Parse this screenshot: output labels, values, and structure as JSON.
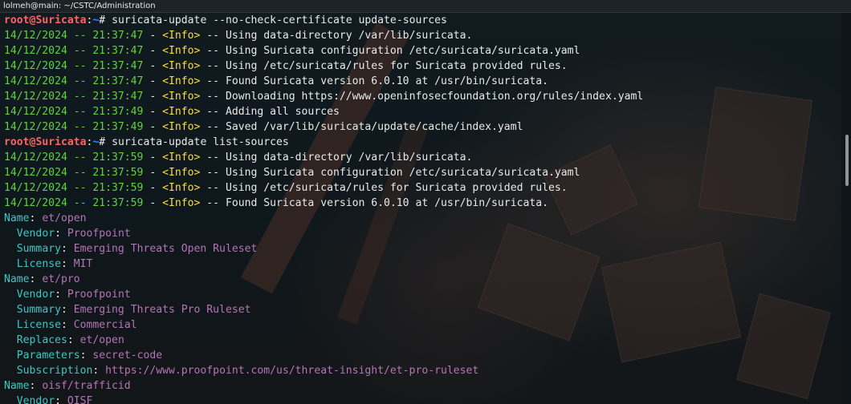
{
  "window": {
    "title": "lolmeh@main: ~/CSTC/Administration"
  },
  "prompt": {
    "user": "root",
    "at": "@",
    "host": "Suricata",
    "colon": ":",
    "path": "~",
    "symbol": "# "
  },
  "commands": [
    "suricata-update --no-check-certificate update-sources",
    "suricata-update list-sources"
  ],
  "log_block_1": [
    {
      "time": "14/12/2024 -- 21:37:47",
      "level": "<Info>",
      "message": "Using data-directory /var/lib/suricata."
    },
    {
      "time": "14/12/2024 -- 21:37:47",
      "level": "<Info>",
      "message": "Using Suricata configuration /etc/suricata/suricata.yaml"
    },
    {
      "time": "14/12/2024 -- 21:37:47",
      "level": "<Info>",
      "message": "Using /etc/suricata/rules for Suricata provided rules."
    },
    {
      "time": "14/12/2024 -- 21:37:47",
      "level": "<Info>",
      "message": "Found Suricata version 6.0.10 at /usr/bin/suricata."
    },
    {
      "time": "14/12/2024 -- 21:37:47",
      "level": "<Info>",
      "message": "Downloading https://www.openinfosecfoundation.org/rules/index.yaml"
    },
    {
      "time": "14/12/2024 -- 21:37:49",
      "level": "<Info>",
      "message": "Adding all sources"
    },
    {
      "time": "14/12/2024 -- 21:37:49",
      "level": "<Info>",
      "message": "Saved /var/lib/suricata/update/cache/index.yaml"
    }
  ],
  "log_block_2": [
    {
      "time": "14/12/2024 -- 21:37:59",
      "level": "<Info>",
      "message": "Using data-directory /var/lib/suricata."
    },
    {
      "time": "14/12/2024 -- 21:37:59",
      "level": "<Info>",
      "message": "Using Suricata configuration /etc/suricata/suricata.yaml"
    },
    {
      "time": "14/12/2024 -- 21:37:59",
      "level": "<Info>",
      "message": "Using /etc/suricata/rules for Suricata provided rules."
    },
    {
      "time": "14/12/2024 -- 21:37:59",
      "level": "<Info>",
      "message": "Found Suricata version 6.0.10 at /usr/bin/suricata."
    }
  ],
  "sources": [
    {
      "indent": "",
      "key": "Name",
      "value": "et/open"
    },
    {
      "indent": "  ",
      "key": "Vendor",
      "value": "Proofpoint"
    },
    {
      "indent": "  ",
      "key": "Summary",
      "value": "Emerging Threats Open Ruleset"
    },
    {
      "indent": "  ",
      "key": "License",
      "value": "MIT"
    },
    {
      "indent": "",
      "key": "Name",
      "value": "et/pro"
    },
    {
      "indent": "  ",
      "key": "Vendor",
      "value": "Proofpoint"
    },
    {
      "indent": "  ",
      "key": "Summary",
      "value": "Emerging Threats Pro Ruleset"
    },
    {
      "indent": "  ",
      "key": "License",
      "value": "Commercial"
    },
    {
      "indent": "  ",
      "key": "Replaces",
      "value": "et/open"
    },
    {
      "indent": "  ",
      "key": "Parameters",
      "value": "secret-code"
    },
    {
      "indent": "  ",
      "key": "Subscription",
      "value": "https://www.proofpoint.com/us/threat-insight/et-pro-ruleset"
    },
    {
      "indent": "",
      "key": "Name",
      "value": "oisf/trafficid"
    },
    {
      "indent": "  ",
      "key": "Vendor",
      "value": "OISF"
    }
  ],
  "separators": {
    "log": " - ",
    "msg": " -- ",
    "kv": ": "
  },
  "colors": {
    "prompt": "#ff6363",
    "path": "#3d85ff",
    "timestamp": "#5fd43c",
    "info": "#fcdc3c",
    "key": "#3ec7c4",
    "value": "#b574b6",
    "text": "#e9e9e9"
  }
}
